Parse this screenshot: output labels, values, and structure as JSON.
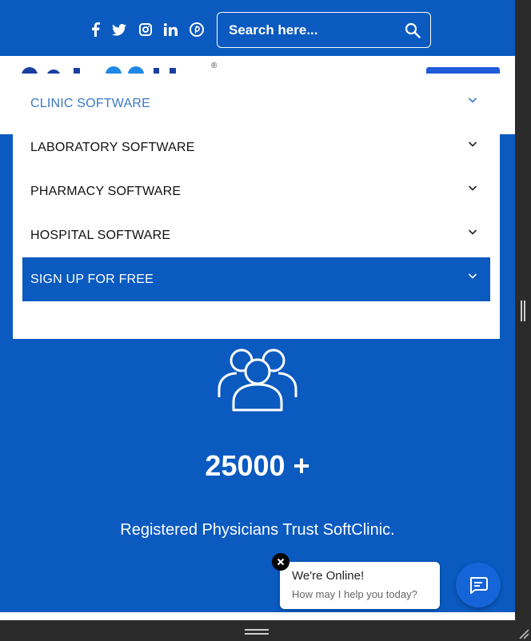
{
  "social": {
    "icons": [
      "facebook-icon",
      "twitter-icon",
      "instagram-icon",
      "linkedin-icon",
      "pinterest-icon"
    ]
  },
  "search": {
    "placeholder": "Search here...",
    "value": ""
  },
  "header": {
    "registered_mark": "®"
  },
  "menu": {
    "items": [
      {
        "label": "CLINIC SOFTWARE"
      },
      {
        "label": "LABORATORY SOFTWARE"
      },
      {
        "label": "PHARMACY SOFTWARE"
      },
      {
        "label": "HOSPITAL SOFTWARE"
      },
      {
        "label": "SIGN UP FOR FREE"
      }
    ]
  },
  "stats": {
    "number": "25000 +",
    "caption": "Registered Physicians Trust SoftClinic."
  },
  "chat": {
    "title": "We're Online!",
    "subtitle": "How may I help you today?"
  },
  "colors": {
    "brand_blue": "#0a5ac0",
    "active_link": "#3a78c6",
    "launcher": "#1665d8"
  }
}
